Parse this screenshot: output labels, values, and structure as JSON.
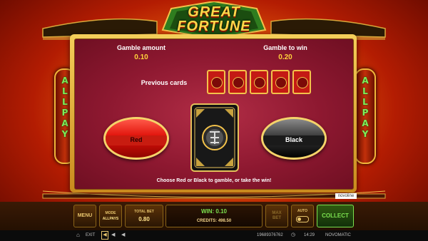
{
  "logo": {
    "line1": "GREAT",
    "line2": "FORTUNE"
  },
  "pillars": {
    "text": "ALLPAY"
  },
  "gamble": {
    "amount_label": "Gamble amount",
    "amount_value": "0.10",
    "win_label": "Gamble to win",
    "win_value": "0.20",
    "previous_label": "Previous cards",
    "previous_count": 5,
    "red_label": "Red",
    "black_label": "Black",
    "hint": "Choose Red or Black to gamble, or take the win!"
  },
  "novomatic_badge": "novoline",
  "controls": {
    "menu": "MENU",
    "mode_label": "MODE",
    "mode_value": "ALLPAYS",
    "total_bet_label": "TOTAL BET",
    "total_bet_value": "0.80",
    "win_text": "WIN: 0.10",
    "credits_text": "CREDITS: 498.50",
    "max_bet_line1": "MAX",
    "max_bet_line2": "BET",
    "auto_label": "AUTO",
    "collect": "COLLECT"
  },
  "status_bar": {
    "exit": "EXIT",
    "game_id": "19689376762",
    "time": "14:29",
    "brand": "NOVOMATIC"
  },
  "colors": {
    "win_green": "#7ce24f",
    "gold": "#e7c46c",
    "red": "#d81a12"
  }
}
